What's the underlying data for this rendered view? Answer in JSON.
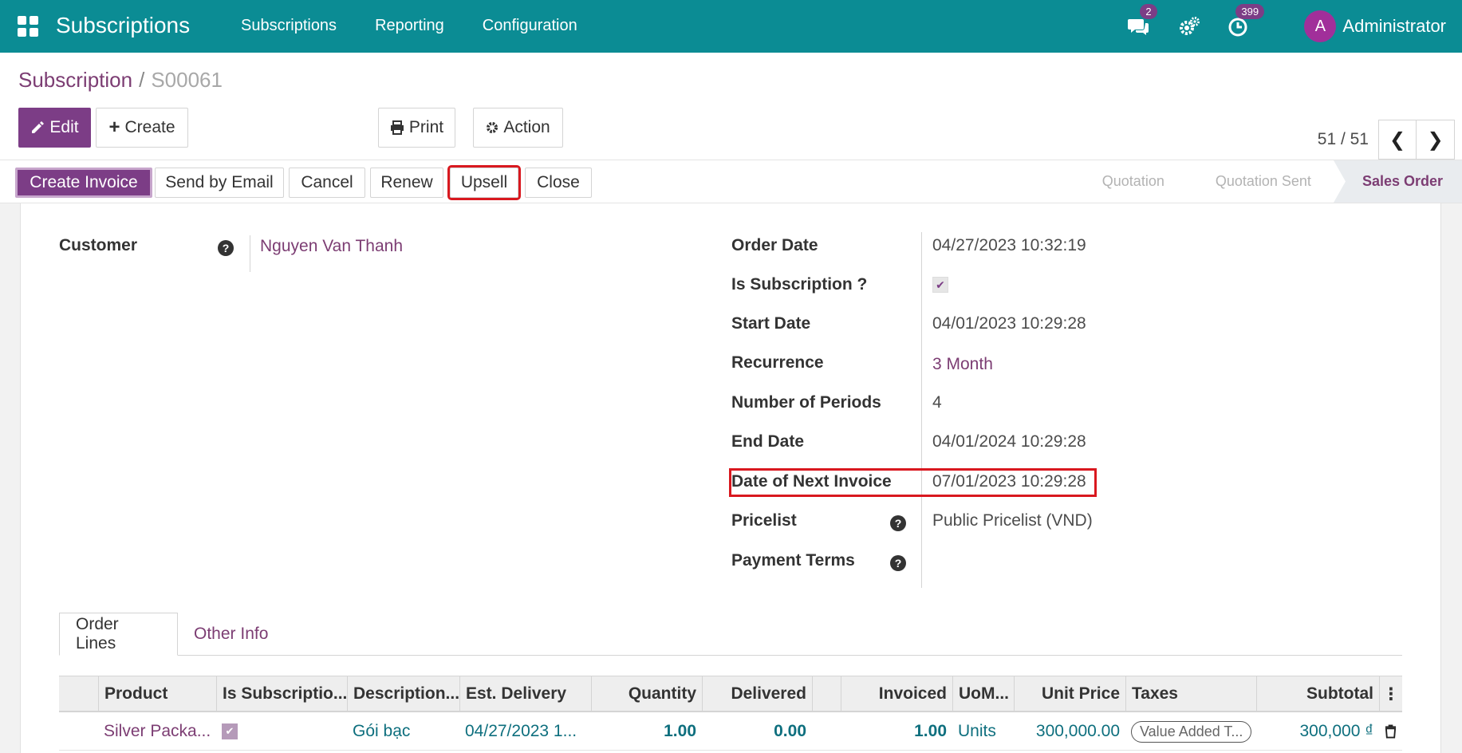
{
  "navbar": {
    "app_title": "Subscriptions",
    "menu": [
      "Subscriptions",
      "Reporting",
      "Configuration"
    ],
    "messages_count": "2",
    "activities_count": "399",
    "avatar_letter": "A",
    "user_name": "Administrator"
  },
  "breadcrumb": {
    "parent": "Subscription",
    "separator": "/",
    "current": "S00061"
  },
  "control": {
    "edit_label": "Edit",
    "create_label": "Create",
    "print_label": "Print",
    "action_label": "Action",
    "pager": "51 / 51"
  },
  "statusbar": {
    "buttons": [
      "Create Invoice",
      "Send by Email",
      "Cancel",
      "Renew",
      "Upsell",
      "Close"
    ],
    "stages": [
      "Quotation",
      "Quotation Sent",
      "Sales Order"
    ],
    "active_stage": "Sales Order"
  },
  "form": {
    "customer_label": "Customer",
    "customer_value": "Nguyen Van Thanh",
    "order_date_label": "Order Date",
    "order_date_value": "04/27/2023 10:32:19",
    "is_subscription_label": "Is Subscription ?",
    "is_subscription_value": true,
    "start_date_label": "Start Date",
    "start_date_value": "04/01/2023 10:29:28",
    "recurrence_label": "Recurrence",
    "recurrence_value": "3 Month",
    "periods_label": "Number of Periods",
    "periods_value": "4",
    "end_date_label": "End Date",
    "end_date_value": "04/01/2024 10:29:28",
    "next_invoice_label": "Date of Next Invoice",
    "next_invoice_value": "07/01/2023 10:29:28",
    "pricelist_label": "Pricelist",
    "pricelist_value": "Public Pricelist (VND)",
    "payment_terms_label": "Payment Terms",
    "payment_terms_value": ""
  },
  "tabs": [
    "Order Lines",
    "Other Info"
  ],
  "table": {
    "headers": [
      "Product",
      "Is Subscriptio...",
      "Description...",
      "Est. Delivery",
      "Quantity",
      "Delivered",
      "Invoiced",
      "UoM...",
      "Unit Price",
      "Taxes",
      "Subtotal"
    ],
    "rows": [
      {
        "product": "Silver Packa...",
        "is_subscription": true,
        "description": "Gói bạc",
        "est_delivery": "04/27/2023 1...",
        "quantity": "1.00",
        "delivered": "0.00",
        "invoiced": "1.00",
        "uom": "Units",
        "unit_price": "300,000.00",
        "taxes": "Value Added T...",
        "subtotal": "300,000 ₫"
      }
    ]
  },
  "icons": {
    "apps": "apps-grid-icon",
    "messages": "chat-icon",
    "settings": "gears-icon",
    "activity": "clock-icon",
    "edit": "pencil-icon",
    "create": "plus-icon",
    "print": "printer-icon",
    "action": "gear-icon",
    "help": "question-circle-icon",
    "delete": "trash-icon"
  },
  "colors": {
    "navbar": "#0b8c94",
    "primary": "#7c3d86",
    "link": "#7c3d73",
    "highlight": "#d9181f",
    "numbers": "#0e6f7e"
  }
}
